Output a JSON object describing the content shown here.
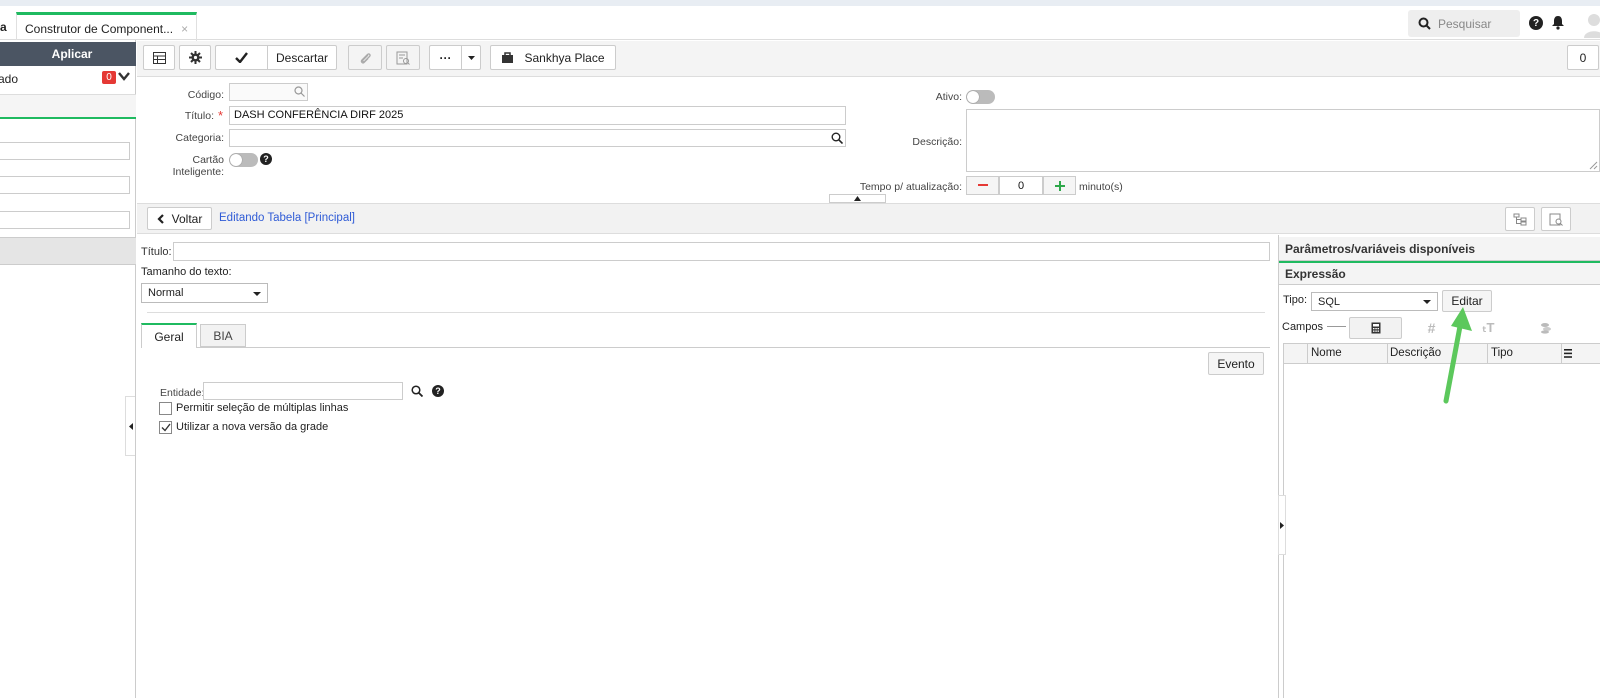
{
  "tabs": {
    "prev_tab_fragment": "a",
    "active_tab_label": "Construtor de Component...",
    "active_tab_close": "×"
  },
  "topbar": {
    "search_placeholder": "Pesquisar"
  },
  "left_panel": {
    "apply_label": "Aplicar",
    "filter_label": "ado",
    "filter_count": "0"
  },
  "toolbar": {
    "discard_label": "Descartar",
    "more_label": "···",
    "sankhya_place_label": "Sankhya Place",
    "counter": "0"
  },
  "form": {
    "codigo_label": "Código:",
    "titulo_label": "Título:",
    "required_mark": "*",
    "titulo_value": "DASH CONFERÊNCIA DIRF 2025",
    "categoria_label": "Categoria:",
    "cartao_label": "Cartão Inteligente:",
    "ativo_label": "Ativo:",
    "descricao_label": "Descrição:",
    "tempo_label": "Tempo p/ atualização:",
    "tempo_value": "0",
    "tempo_unit": "minuto(s)"
  },
  "nav": {
    "back_label": "Voltar",
    "editing_label": "Editando Tabela [Principal]"
  },
  "editor": {
    "titulo_label": "Título:",
    "tamanho_label": "Tamanho do texto:",
    "tamanho_value": "Normal",
    "tabs": [
      "Geral",
      "BIA"
    ],
    "evento_label": "Evento",
    "entidade_label": "Entidade:",
    "multi_select_label": "Permitir seleção de múltiplas linhas",
    "multi_select_checked": false,
    "new_grid_label": "Utilizar a nova versão da grade",
    "new_grid_checked": true
  },
  "right_panel": {
    "params_header": "Parâmetros/variáveis disponíveis",
    "expr_header": "Expressão",
    "tipo_label": "Tipo:",
    "tipo_value": "SQL",
    "editar_label": "Editar",
    "campos_label": "Campos",
    "columns": [
      "Nome",
      "Descrição",
      "Tipo"
    ]
  },
  "colors": {
    "accent_green": "#1fba60",
    "link_blue": "#2f5bd6",
    "badge_red": "#e53935",
    "arrow_green": "#5cc85c",
    "minus_red": "#e53935",
    "plus_green": "#2ea84a"
  }
}
